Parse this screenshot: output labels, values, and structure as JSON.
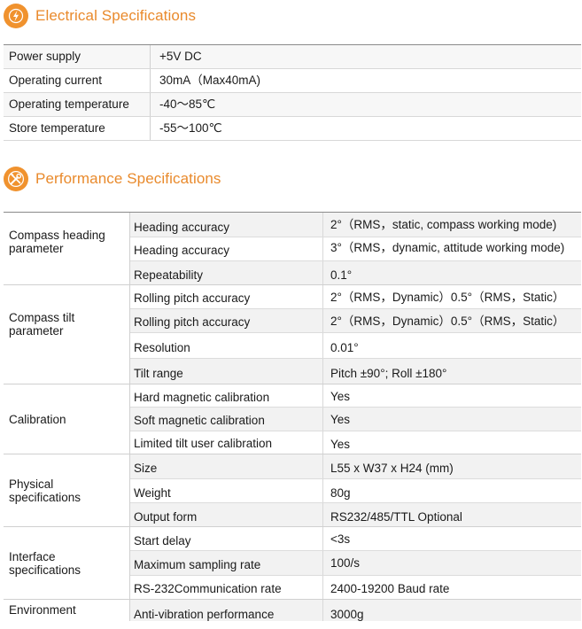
{
  "electrical": {
    "title": "Electrical Specifications",
    "icon": "lightning-bolt-icon",
    "rows": [
      {
        "label": "Power supply",
        "value": "+5V DC"
      },
      {
        "label": "Operating  current",
        "value": "30mA（Max40mA)"
      },
      {
        "label": "Operating  temperature",
        "value": "-40～85℃"
      },
      {
        "label": "Store temperature",
        "value": "-55～100℃"
      }
    ]
  },
  "performance": {
    "title": "Performance Specifications",
    "icon": "tools-wrench-icon",
    "groups": [
      {
        "label": "Compass heading parameter",
        "rows": [
          {
            "param": "Heading accuracy",
            "value": "2°（RMS，static, compass working mode)"
          },
          {
            "param": "Heading accuracy",
            "value": "3°（RMS，dynamic, attitude working mode)"
          },
          {
            "param": "Repeatability",
            "value": "0.1°"
          }
        ]
      },
      {
        "label": "Compass tilt parameter",
        "rows": [
          {
            "param": "Rolling pitch accuracy",
            "value": "2°（RMS，Dynamic）0.5°（RMS，Static）"
          },
          {
            "param": "Rolling pitch accuracy",
            "value": "2°（RMS，Dynamic）0.5°（RMS，Static）"
          },
          {
            "param": "Resolution",
            "value": "0.01°"
          },
          {
            "param": "Tilt range",
            "value": "Pitch ±90°;   Roll ±180°"
          }
        ]
      },
      {
        "label": "Calibration",
        "rows": [
          {
            "param": "Hard magnetic calibration",
            "value": "Yes"
          },
          {
            "param": "Soft magnetic calibration",
            "value": "Yes"
          },
          {
            "param": "Limited tilt user calibration",
            "value": "Yes"
          }
        ]
      },
      {
        "label": "Physical specifications",
        "rows": [
          {
            "param": "Size",
            "value": "L55 x W37 x H24 (mm)"
          },
          {
            "param": "Weight",
            "value": "80g"
          },
          {
            "param": "Output form",
            "value": "RS232/485/TTL Optional"
          }
        ]
      },
      {
        "label": "Interface specifications",
        "rows": [
          {
            "param": "Start delay",
            "value": "<3s"
          },
          {
            "param": "Maximum sampling rate",
            "value": "100/s"
          },
          {
            "param": "RS-232Communication rate",
            "value": "2400-19200 Baud rate"
          }
        ]
      },
      {
        "label": "Environment",
        "rows": [
          {
            "param": "Anti-vibration performance",
            "value": "3000g"
          }
        ]
      }
    ]
  },
  "colors": {
    "accent": "#f0922e",
    "title_text": "#e98a2c",
    "rule": "#8a8a8a"
  }
}
